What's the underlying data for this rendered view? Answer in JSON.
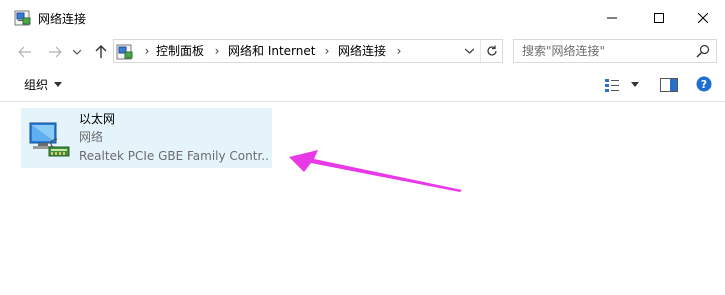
{
  "window": {
    "title": "网络连接",
    "icon": "network-connections-icon"
  },
  "caption_buttons": {
    "minimize_icon": "minimize-icon",
    "maximize_icon": "maximize-icon",
    "close_icon": "close-icon"
  },
  "navigation": {
    "back_icon": "arrow-left-icon",
    "forward_icon": "arrow-right-icon",
    "recent_icon": "chevron-down-icon",
    "up_icon": "arrow-up-icon"
  },
  "address_bar": {
    "breadcrumbs": [
      "控制面板",
      "网络和 Internet",
      "网络连接"
    ],
    "refresh_icon": "refresh-icon"
  },
  "search": {
    "placeholder": "搜索\"网络连接\""
  },
  "command_bar": {
    "organize_label": "组织",
    "view_icon": "change-view-icon",
    "preview_pane_icon": "preview-pane-icon",
    "help_icon": "help-icon"
  },
  "connections": [
    {
      "name": "以太网",
      "status": "网络",
      "device": "Realtek PCIe GBE Family Contr..."
    }
  ],
  "annotation": {
    "arrow_color": "#e838e8"
  }
}
